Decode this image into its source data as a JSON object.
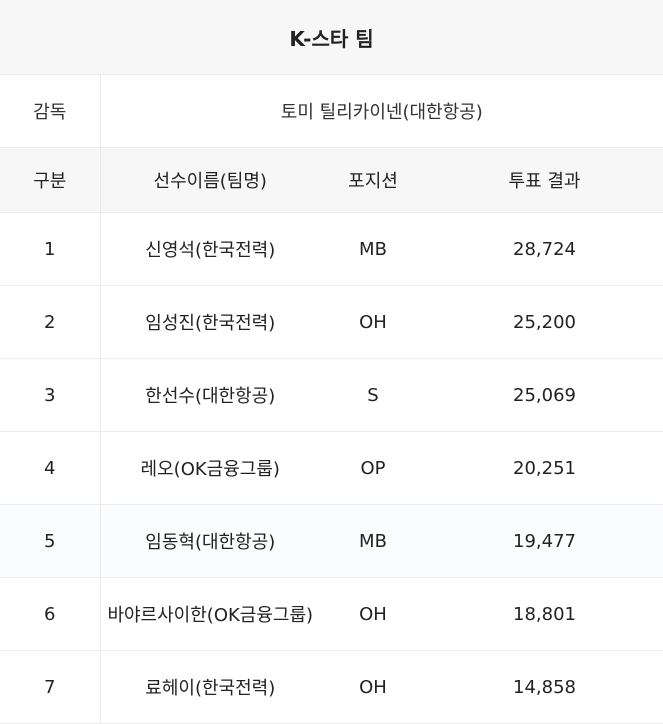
{
  "title": "K-스타 팀",
  "coach": {
    "label": "감독",
    "name": "토미 틸리카이넨(대한항공)"
  },
  "columns": [
    "구분",
    "선수이름(팀명)",
    "포지션",
    "투표 결과"
  ],
  "rows": [
    {
      "rank": "1",
      "player": "신영석(한국전력)",
      "position": "MB",
      "votes": "28,724"
    },
    {
      "rank": "2",
      "player": "임성진(한국전력)",
      "position": "OH",
      "votes": "25,200"
    },
    {
      "rank": "3",
      "player": "한선수(대한항공)",
      "position": "S",
      "votes": "25,069"
    },
    {
      "rank": "4",
      "player": "레오(OK금융그룹)",
      "position": "OP",
      "votes": "20,251"
    },
    {
      "rank": "5",
      "player": "임동혁(대한항공)",
      "position": "MB",
      "votes": "19,477"
    },
    {
      "rank": "6",
      "player": "바야르사이한(OK금융그룹)",
      "position": "OH",
      "votes": "18,801"
    },
    {
      "rank": "7",
      "player": "료헤이(한국전력)",
      "position": "OH",
      "votes": "14,858"
    }
  ]
}
